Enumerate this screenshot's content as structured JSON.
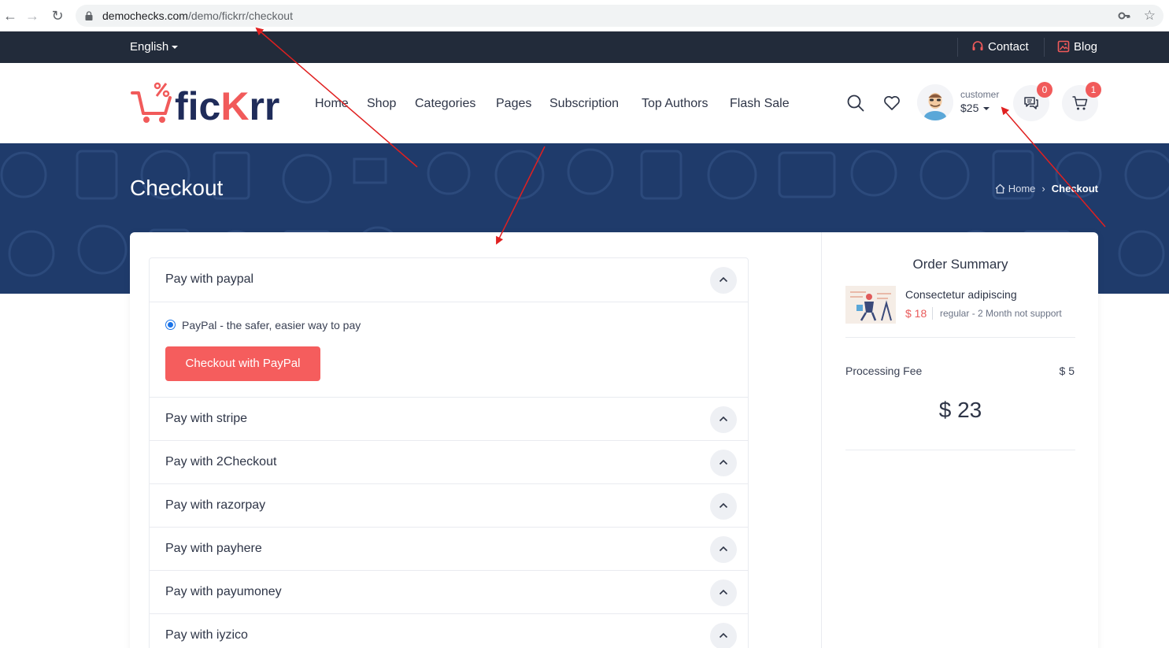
{
  "browser": {
    "url_host": "demochecks.com",
    "url_path": "/demo/fickrr/checkout"
  },
  "topbar": {
    "language": "English",
    "contact": "Contact",
    "blog": "Blog"
  },
  "header": {
    "logo_prefix": "fic",
    "logo_k": "K",
    "logo_suffix": "rr",
    "menu": [
      "Home",
      "Shop",
      "Categories",
      "Pages",
      "Subscription",
      "Top Authors",
      "Flash Sale"
    ],
    "account_label": "customer",
    "account_balance": "$25",
    "messages_count": "0",
    "cart_count": "1"
  },
  "hero": {
    "title": "Checkout",
    "breadcrumb_home": "Home",
    "breadcrumb_current": "Checkout"
  },
  "payment": {
    "methods": [
      "Pay with paypal",
      "Pay with stripe",
      "Pay with 2Checkout",
      "Pay with razorpay",
      "Pay with payhere",
      "Pay with payumoney",
      "Pay with iyzico"
    ],
    "paypal_option": "PayPal - the safer, easier way to pay",
    "paypal_button": "Checkout with PayPal"
  },
  "summary": {
    "title": "Order Summary",
    "item_name": "Consectetur adipiscing",
    "item_price": "$ 18",
    "item_license": "regular - 2 Month not support",
    "fee_label": "Processing Fee",
    "fee_value": "$ 5",
    "total": "$ 23"
  },
  "colors": {
    "brand_navy": "#1f2c5a",
    "accent_red": "#f55d5d",
    "hero_bg": "#1f3b6b",
    "topbar_bg": "#222b3a",
    "annotation_arrow": "#e02020"
  }
}
